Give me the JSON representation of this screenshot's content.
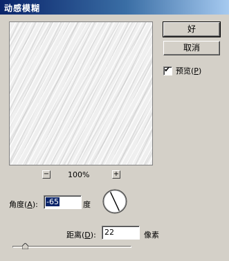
{
  "window": {
    "title": "动感模糊"
  },
  "buttons": {
    "ok": "好",
    "cancel": "取消"
  },
  "preview_checkbox": {
    "label": "预览",
    "accel": "P",
    "checked": true
  },
  "zoom": {
    "minus": "−",
    "plus": "+",
    "level": "100%"
  },
  "angle": {
    "label": "角度",
    "accel": "A",
    "value": "-65",
    "unit": "度"
  },
  "distance": {
    "label": "距离",
    "accel": "D",
    "value": "22",
    "unit": "像素",
    "slider_fraction": 0.11
  },
  "colors": {
    "titlebar_start": "#0a246a",
    "titlebar_end": "#a6caf0",
    "dialog_bg": "#d4d0c8",
    "selection": "#0a246a"
  },
  "icons": {
    "checkmark": "checkmark-icon",
    "dial": "angle-dial-icon",
    "slider": "slider-thumb-icon"
  }
}
